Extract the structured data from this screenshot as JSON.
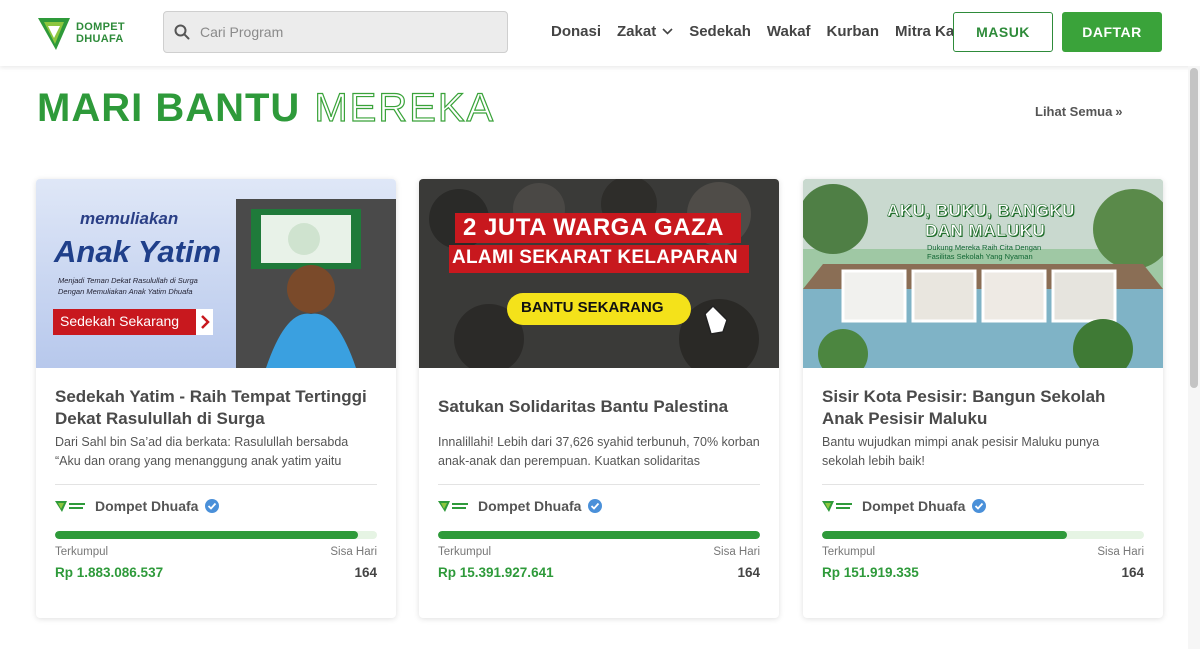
{
  "header": {
    "logo": {
      "line1": "DOMPET",
      "line2": "DHUAFA"
    },
    "search": {
      "placeholder": "Cari Program"
    },
    "nav": [
      "Donasi",
      "Zakat",
      "Sedekah",
      "Wakaf",
      "Kurban",
      "Mitra Kami"
    ],
    "login_label": "MASUK",
    "register_label": "DAFTAR"
  },
  "section": {
    "title_solid": "MARI BANTU",
    "title_outline": "MEREKA",
    "see_all": "Lihat Semua"
  },
  "cards": [
    {
      "image": {
        "line1": "memuliakan",
        "line2": "Anak Yatim",
        "caption1": "Menjadi Teman Dekat Rasulullah di Surga",
        "caption2": "Dengan Memuliakan Anak Yatim Dhuafa",
        "cta": "Sedekah Sekarang"
      },
      "title": "Sedekah Yatim - Raih Tempat Tertinggi Dekat Rasulullah di Surga",
      "desc": "Dari Sahl bin Sa’ad dia berkata: Rasulullah bersabda “Aku dan orang yang menanggung anak yatim yaitu",
      "org": "Dompet Dhuafa",
      "progress": 0.94,
      "collected_label": "Terkumpul",
      "days_label": "Sisa Hari",
      "amount": "Rp 1.883.086.537",
      "days": "164"
    },
    {
      "image": {
        "line1": "2 JUTA WARGA GAZA",
        "line2": "ALAMI SEKARAT KELAPARAN",
        "cta": "BANTU SEKARANG"
      },
      "title": "Satukan Solidaritas Bantu Palestina",
      "desc": "Innalillahi! Lebih dari 37,626 syahid terbunuh, 70% korban anak-anak dan perempuan. Kuatkan solidaritas",
      "org": "Dompet Dhuafa",
      "progress": 1.0,
      "collected_label": "Terkumpul",
      "days_label": "Sisa Hari",
      "amount": "Rp 15.391.927.641",
      "days": "164"
    },
    {
      "image": {
        "line1": "AKU, BUKU, BANGKU",
        "line2": "DAN MALUKU",
        "caption1": "Dukung Mereka Raih Cita Dengan",
        "caption2": "Fasilitas Sekolah Yang Nyaman"
      },
      "title": "Sisir Kota Pesisir: Bangun Sekolah Anak Pesisir Maluku",
      "desc": "Bantu wujudkan mimpi anak pesisir Maluku punya sekolah lebih baik!",
      "org": "Dompet Dhuafa",
      "progress": 0.76,
      "collected_label": "Terkumpul",
      "days_label": "Sisa Hari",
      "amount": "Rp 151.919.335",
      "days": "164"
    }
  ],
  "colors": {
    "brand_green": "#2e9a3a",
    "button_green": "#3aa33a",
    "verified_blue": "#4a90d9"
  }
}
